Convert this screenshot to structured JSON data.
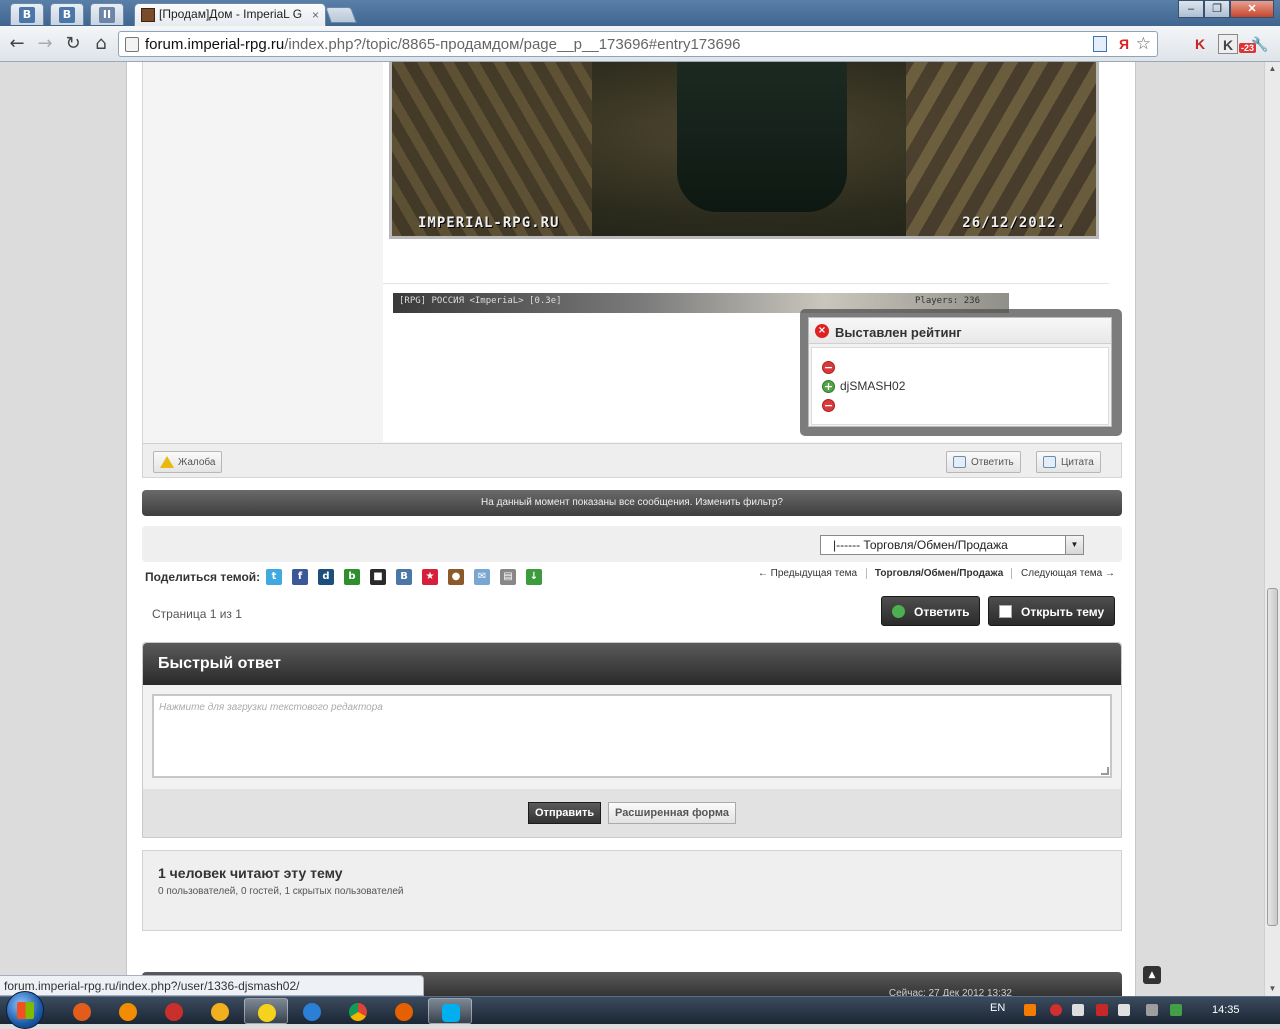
{
  "browser": {
    "pinned_tabs": [
      "В",
      "В",
      "II"
    ],
    "tab_title": "[Продам]Дом - ImperiaL G",
    "tab_close": "×",
    "url_host": "forum.imperial-rpg.ru",
    "url_path": "/index.php?/topic/8865-продамдом/page__p__173696#entry173696",
    "ext_badge": "-23",
    "window_buttons": [
      "–",
      "❐",
      "✕"
    ]
  },
  "post": {
    "screenshot_watermark_left": "IMPERIAL-RPG.RU",
    "screenshot_watermark_right": "26/12/2012.",
    "screenshot2_server": "[RPG] РОССИЯ <ImperiaL> [0.3e]",
    "screenshot2_players": "Players: 236",
    "report_label": "Жалоба",
    "reply_label": "Ответить",
    "quote_label": "Цитата"
  },
  "rating_popup": {
    "title": "Выставлен рейтинг",
    "close_glyph": "×",
    "entries": [
      {
        "type": "minus",
        "glyph": "−",
        "name": ""
      },
      {
        "type": "plus",
        "glyph": "+",
        "name": "djSMASH02"
      },
      {
        "type": "minus",
        "glyph": "−",
        "name": ""
      }
    ]
  },
  "filter_bar": {
    "text": "На данный момент показаны все сообщения. Изменить фильтр?"
  },
  "jump": {
    "selected": "|------ Торговля/Обмен/Продажа",
    "arrow": "▼"
  },
  "share": {
    "label": "Поделиться темой:",
    "icons": [
      {
        "name": "twitter-icon",
        "color": "#3fa9e0",
        "glyph": "t"
      },
      {
        "name": "facebook-icon",
        "color": "#3b5998",
        "glyph": "f"
      },
      {
        "name": "digg-icon",
        "color": "#1d4f7c",
        "glyph": "d"
      },
      {
        "name": "buzz-icon",
        "color": "#2f8f2f",
        "glyph": "b"
      },
      {
        "name": "delicious-icon",
        "color": "#2a2a2a",
        "glyph": "■"
      },
      {
        "name": "vkontakte-icon",
        "color": "#4a76a8",
        "glyph": "B"
      },
      {
        "name": "mister-wong-icon",
        "color": "#d61f3a",
        "glyph": "★"
      },
      {
        "name": "moikrug-icon",
        "color": "#8a5a2b",
        "glyph": "●"
      },
      {
        "name": "email-icon",
        "color": "#7aa7d2",
        "glyph": "✉"
      },
      {
        "name": "print-icon",
        "color": "#888888",
        "glyph": "▤"
      },
      {
        "name": "download-icon",
        "color": "#3c9b3c",
        "glyph": "↓"
      }
    ]
  },
  "topic_nav": {
    "prev": "← Предыдущая тема",
    "current": "Торговля/Обмен/Продажа",
    "next": "Следующая тема →"
  },
  "pagination": {
    "text": "Страница 1 из 1"
  },
  "actions": {
    "reply": "Ответить",
    "new_topic": "Открыть тему"
  },
  "quick_reply": {
    "title": "Быстрый ответ",
    "placeholder": "Нажмите для загрузки текстового редактора",
    "submit": "Отправить",
    "advanced": "Расширенная форма"
  },
  "readers": {
    "title": "1 человек читают эту тему",
    "detail": "0 пользователей, 0 гостей, 1 скрытых пользователей"
  },
  "footer": {
    "time": "Сейчас: 27 Дек 2012 13:32",
    "top_arrow": "▲"
  },
  "statusbar": {
    "url": "forum.imperial-rpg.ru/index.php?/user/1336-djsmash02/"
  },
  "taskbar": {
    "lang": "EN",
    "clock": "14:35"
  }
}
